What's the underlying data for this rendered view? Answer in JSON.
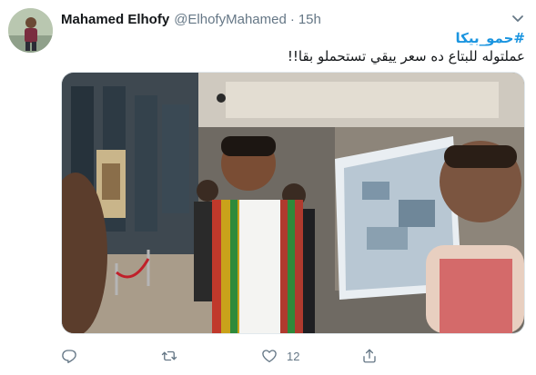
{
  "tweet": {
    "author_name": "Mahamed Elhofy",
    "author_handle": "@ElhofyMahamed",
    "separator": "·",
    "time": "15h",
    "hashtag": "#حمو_بيكا",
    "text": "عملتوله للبتاع ده سعر ييقي تستحملو بقا!!",
    "actions": {
      "reply_count": "",
      "retweet_count": "",
      "like_count": "12"
    }
  },
  "icons": {
    "menu": "chevron-down-icon",
    "reply": "reply-icon",
    "retweet": "retweet-icon",
    "like": "heart-icon",
    "share": "share-icon"
  },
  "colors": {
    "accent": "#1b95e0",
    "secondary_text": "#657786"
  }
}
